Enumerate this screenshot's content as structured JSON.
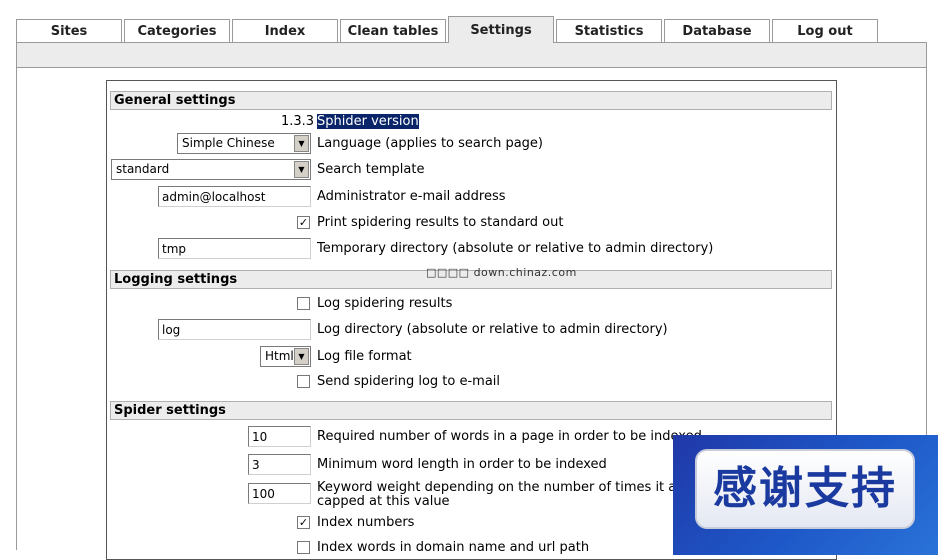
{
  "tabs": [
    {
      "label": "Sites"
    },
    {
      "label": "Categories"
    },
    {
      "label": "Index"
    },
    {
      "label": "Clean tables"
    },
    {
      "label": "Settings",
      "active": true
    },
    {
      "label": "Statistics"
    },
    {
      "label": "Database"
    },
    {
      "label": "Log out"
    }
  ],
  "general": {
    "title": "General settings",
    "version_value": "1.3.3",
    "version_label": "Sphider version",
    "language_value": "Simple Chinese",
    "language_label": "Language (applies to search page)",
    "template_value": "standard",
    "template_label": "Search template",
    "email_value": "admin@localhost",
    "email_label": "Administrator e-mail address",
    "print_checked": true,
    "print_label": "Print spidering results to standard out",
    "tmp_value": "tmp",
    "tmp_label": "Temporary directory (absolute or relative to admin directory)"
  },
  "watermark": "□□□□ down.chinaz.com",
  "logging": {
    "title": "Logging settings",
    "log_results_checked": false,
    "log_results_label": "Log spidering results",
    "log_dir_value": "log",
    "log_dir_label": "Log directory (absolute or relative to admin directory)",
    "format_value": "Html",
    "format_label": "Log file format",
    "send_log_checked": false,
    "send_log_label": "Send spidering log to e-mail"
  },
  "spider": {
    "title": "Spider settings",
    "min_words_value": "10",
    "min_words_label": "Required number of words in a page in order to be indexed",
    "min_len_value": "3",
    "min_len_label": "Minimum word length in order to be indexed",
    "weight_value": "100",
    "weight_label_line1": "Keyword weight depending on the number of times it ap",
    "weight_label_line2": "capped at this value",
    "index_numbers_checked": true,
    "index_numbers_label": "Index numbers",
    "index_domain_checked": false,
    "index_domain_label": "Index words in domain name and url path"
  },
  "overlay_text": "感谢支持"
}
